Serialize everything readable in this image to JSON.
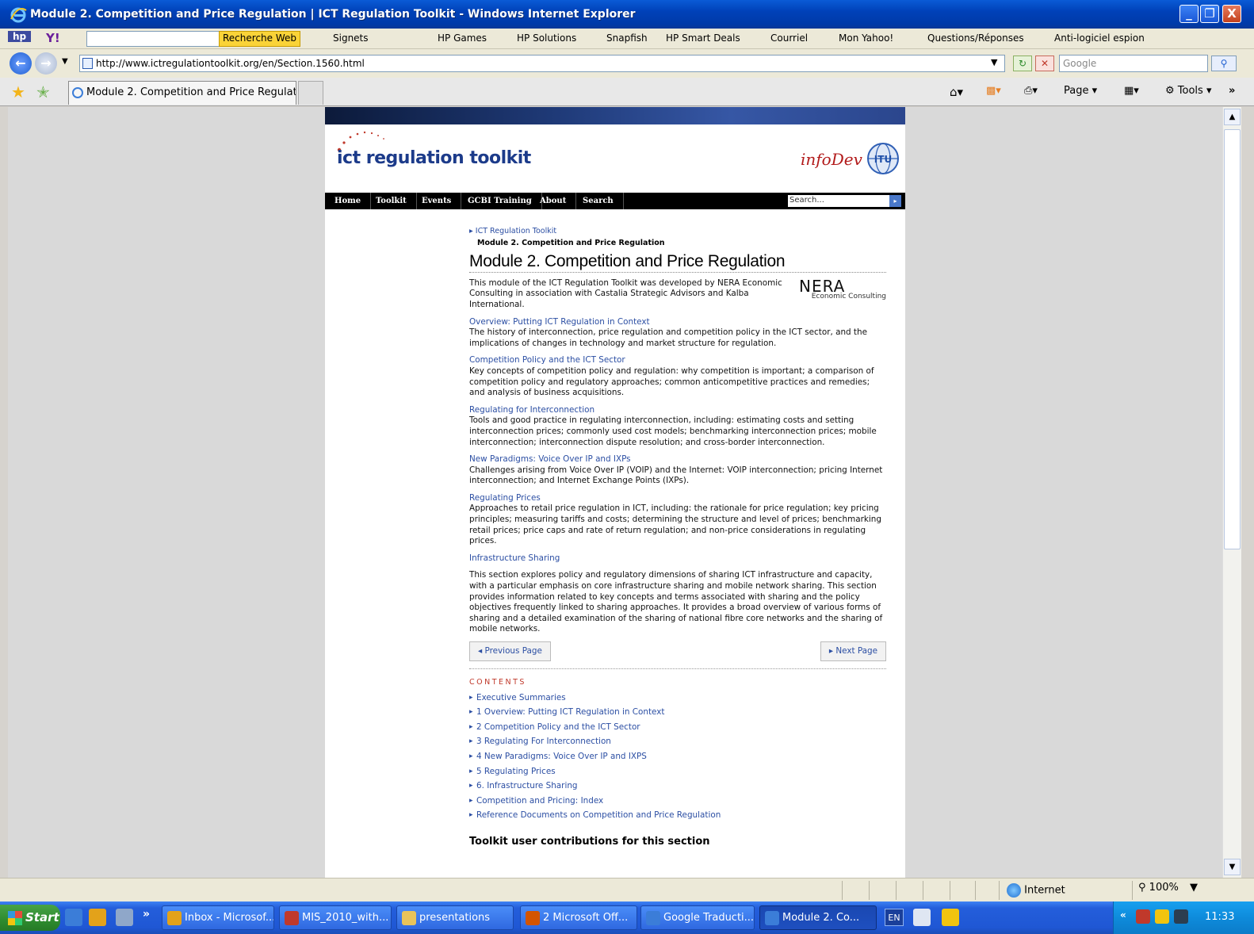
{
  "window": {
    "title": "Module 2. Competition and Price Regulation | ICT Regulation Toolkit - Windows Internet Explorer",
    "min": "_",
    "max": "❐",
    "close": "X"
  },
  "yahoo_toolbar": {
    "search_button": "Recherche Web",
    "items": [
      "Signets",
      "HP Games",
      "HP Solutions",
      "Snapfish",
      "HP Smart Deals",
      "Courriel",
      "Mon Yahoo!",
      "Questions/Réponses",
      "Anti-logiciel espion"
    ]
  },
  "address_bar": {
    "url": "http://www.ictregulationtoolkit.org/en/Section.1560.html",
    "search_placeholder": "Google"
  },
  "tabs": {
    "active_label": "Module 2. Competition and Price Regulatio...",
    "tools": [
      "Page",
      "Tools"
    ]
  },
  "site": {
    "logo_text": "ict regulation toolkit",
    "partner_logo": "infoDev",
    "itu_logo": "ITU",
    "nav": [
      "Home",
      "Toolkit",
      "Events",
      "GCBI Training",
      "About",
      "Search"
    ],
    "search_placeholder": "Search..."
  },
  "breadcrumb": {
    "parent": "ICT Regulation Toolkit",
    "current": "Module 2. Competition and Price Regulation"
  },
  "page_title": "Module 2. Competition and Price Regulation",
  "intro": "This module of the ICT Regulation Toolkit was developed by NERA Economic Consulting in association with Castalia Strategic Advisors and Kalba International.",
  "nera_logo": {
    "name": "NERA",
    "sub": "Economic Consulting"
  },
  "sections": [
    {
      "title": "Overview: Putting ICT Regulation in Context",
      "text": "The history of interconnection, price regulation and competition policy in the ICT sector, and the implications of changes in technology and market structure for regulation."
    },
    {
      "title": "Competition Policy and the ICT Sector",
      "text": "Key concepts of competition policy and regulation: why competition is important; a comparison of competition policy and regulatory approaches; common anticompetitive practices and remedies; and analysis of business acquisitions."
    },
    {
      "title": "Regulating for Interconnection",
      "text": "Tools and good practice in regulating interconnection, including: estimating costs and setting interconnection prices; commonly used cost models; benchmarking interconnection prices; mobile interconnection; interconnection dispute resolution; and cross-border interconnection."
    },
    {
      "title": "New Paradigms: Voice Over IP and IXPs",
      "text": "Challenges arising from Voice Over IP (VOIP) and the Internet: VOIP interconnection; pricing Internet interconnection; and Internet Exchange Points (IXPs)."
    },
    {
      "title": "Regulating Prices",
      "text": "Approaches to retail price regulation in ICT, including: the rationale for price regulation; key pricing principles; measuring tariffs and costs; determining the structure and level of prices; benchmarking retail prices; price caps and rate of return regulation; and non-price considerations in regulating prices."
    },
    {
      "title": "Infrastructure Sharing",
      "text": "This section explores policy and regulatory dimensions of sharing ICT infrastructure and capacity, with a particular emphasis on core infrastructure sharing and mobile network sharing. This section provides information related to key concepts and terms associated with sharing and the policy objectives frequently linked to sharing approaches.  It provides a broad overview of various forms of sharing and a detailed examination of the sharing of national fibre core networks and the sharing of mobile networks."
    }
  ],
  "pager": {
    "prev": "◂ Previous Page",
    "next": "▸ Next Page"
  },
  "contents": {
    "heading": "CONTENTS",
    "items": [
      "Executive Summaries",
      "1 Overview: Putting ICT Regulation in Context",
      "2 Competition Policy and the ICT Sector",
      "3 Regulating For Interconnection",
      "4 New Paradigms: Voice Over IP and IXPS",
      "5 Regulating Prices",
      "6. Infrastructure Sharing",
      "Competition and Pricing: Index",
      "Reference Documents on Competition and Price Regulation"
    ]
  },
  "contributions_heading": "Toolkit user contributions for this section",
  "status_bar": {
    "zone": "Internet",
    "zoom": "100%"
  },
  "taskbar": {
    "start": "Start",
    "items": [
      {
        "label": "Inbox - Microsof...",
        "color": "#e3a21a"
      },
      {
        "label": "MIS_2010_with...",
        "color": "#c0392b"
      },
      {
        "label": "presentations",
        "color": "#e8c35a"
      },
      {
        "label": "2 Microsoft Off...",
        "color": "#d35400"
      },
      {
        "label": "Google Traducti...",
        "color": "#3b7dd8"
      },
      {
        "label": "Module 2. Co...",
        "color": "#3b7dd8"
      }
    ],
    "lang": "EN",
    "clock": "11:33"
  }
}
